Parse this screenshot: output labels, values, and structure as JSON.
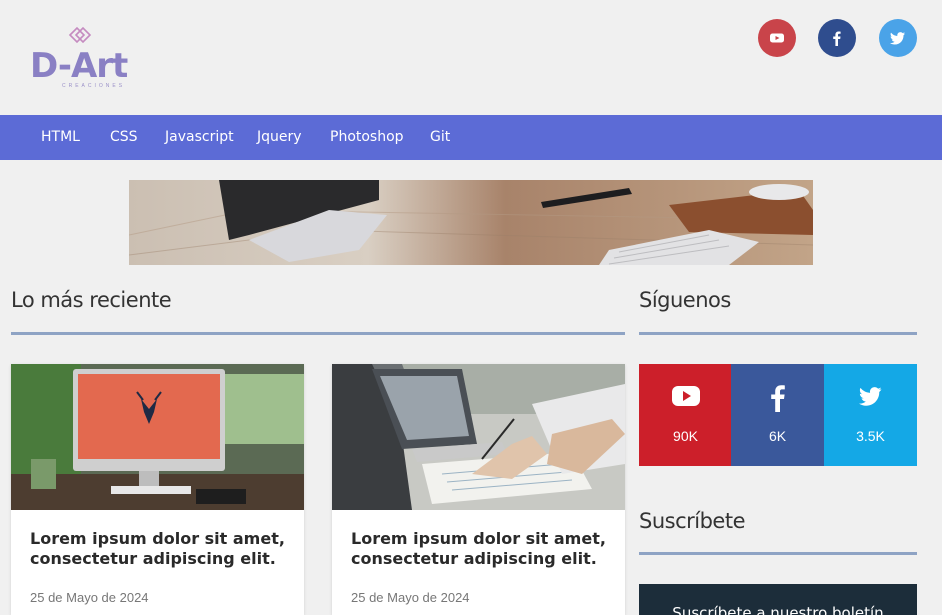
{
  "logo": {
    "text": "D-Art",
    "subtitle": "CREACIONES"
  },
  "social_top": [
    {
      "icon": "youtube-icon",
      "color": "#c9444a"
    },
    {
      "icon": "facebook-icon",
      "color": "#2f4d8e"
    },
    {
      "icon": "twitter-icon",
      "color": "#4aa3e8"
    }
  ],
  "nav": {
    "items": [
      "HTML",
      "CSS",
      "Javascript",
      "Jquery",
      "Photoshop",
      "Git"
    ]
  },
  "colors": {
    "nav_bg": "#5c6bd6",
    "rule": "#8ea3c4",
    "youtube": "#cc1f2a",
    "facebook": "#3a589b",
    "twitter": "#14a8e6",
    "subscribe_bg": "#1c2d3a"
  },
  "recent": {
    "title": "Lo más reciente",
    "cards": [
      {
        "title": "Lorem ipsum dolor sit amet, consectetur adipiscing elit.",
        "date": "25 de Mayo de 2024"
      },
      {
        "title": "Lorem ipsum dolor sit amet, consectetur adipiscing elit.",
        "date": "25 de Mayo de 2024"
      }
    ]
  },
  "follow": {
    "title": "Síguenos",
    "counters": [
      {
        "icon": "youtube-icon",
        "value": "90K"
      },
      {
        "icon": "facebook-icon",
        "value": "6K"
      },
      {
        "icon": "twitter-icon",
        "value": "3.5K"
      }
    ]
  },
  "subscribe": {
    "title": "Suscríbete",
    "box_text": "Suscríbete a nuestro boletín"
  }
}
